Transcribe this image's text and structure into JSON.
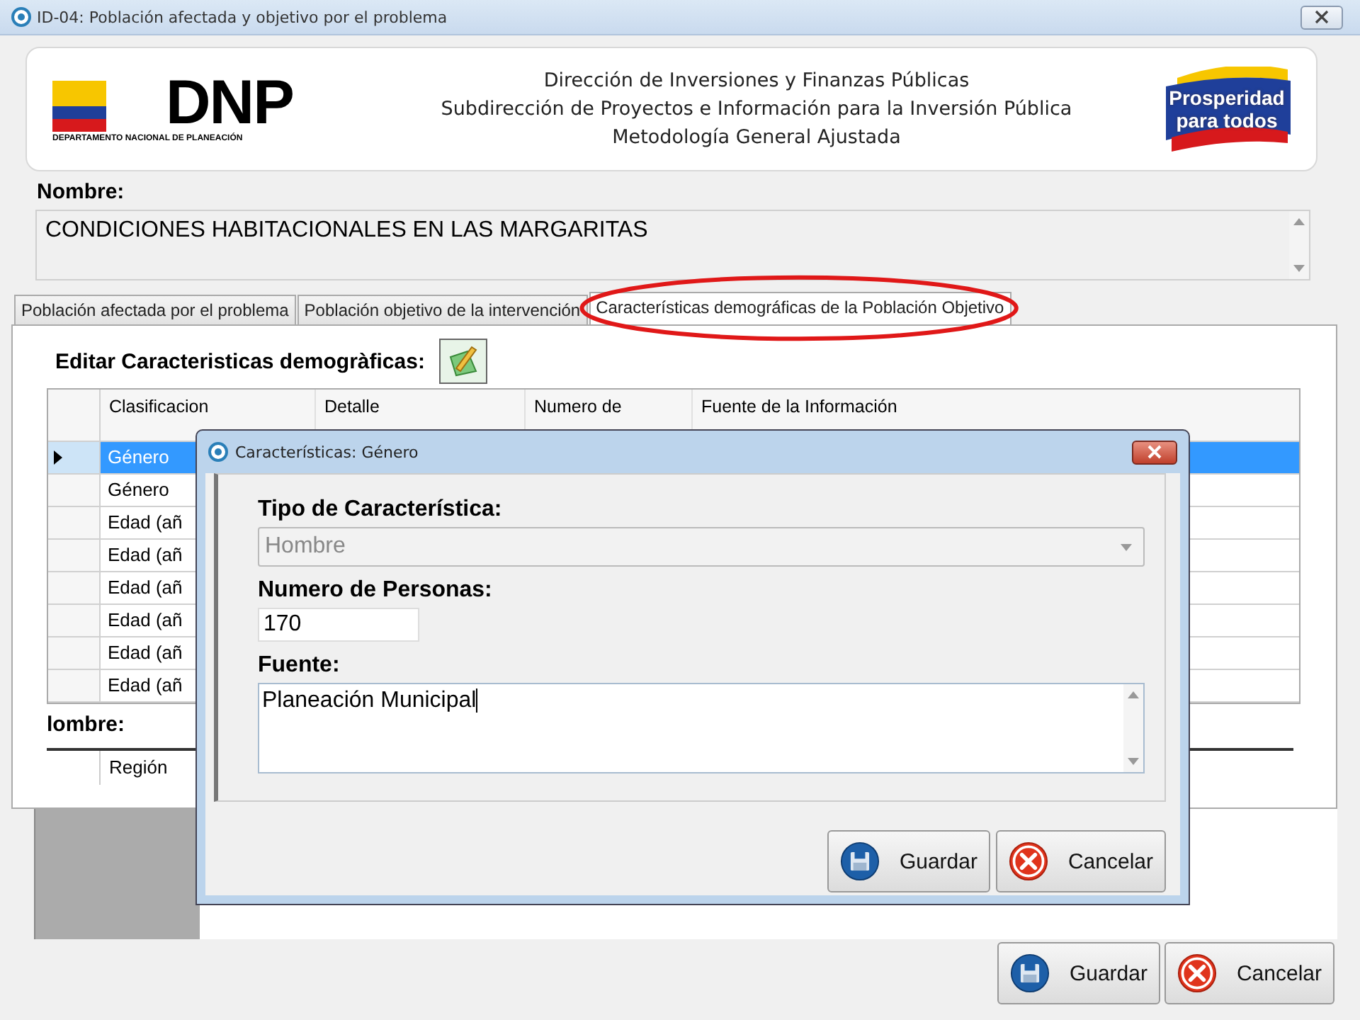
{
  "window": {
    "title": "ID-04: Población afectada y objetivo por el problema"
  },
  "header": {
    "logo_left": {
      "mark": "DNP",
      "caption": "DEPARTAMENTO NACIONAL DE PLANEACIÓN"
    },
    "lines": [
      "Dirección de Inversiones y Finanzas Públicas",
      "Subdirección de Proyectos e Información para la Inversión Pública",
      "Metodología General Ajustada"
    ],
    "logo_right": {
      "line_1": "Prosperidad",
      "line_2": "para todos"
    }
  },
  "nombre": {
    "label": "Nombre:",
    "value": "CONDICIONES HABITACIONALES EN LAS MARGARITAS"
  },
  "tabs": [
    {
      "label": "Población afectada por el problema",
      "selected": false
    },
    {
      "label": "Población objetivo de la intervención",
      "selected": false
    },
    {
      "label": "Características demográficas de la Población Objetivo",
      "selected": true
    }
  ],
  "annotation": {
    "kind": "ellipse"
  },
  "editor": {
    "label": "Editar Caracteristicas demogràficas:"
  },
  "grid": {
    "columns": [
      "Clasificacion",
      "Detalle",
      "Numero de",
      "Fuente de la Información"
    ],
    "rows": [
      {
        "clasificacion": "Género",
        "selected": true
      },
      {
        "clasificacion": "Género",
        "selected": false
      },
      {
        "clasificacion": "Edad (añ",
        "selected": false
      },
      {
        "clasificacion": "Edad (añ",
        "selected": false
      },
      {
        "clasificacion": "Edad (añ",
        "selected": false
      },
      {
        "clasificacion": "Edad (añ",
        "selected": false
      },
      {
        "clasificacion": "Edad (añ",
        "selected": false
      },
      {
        "clasificacion": "Edad (añ",
        "selected": false
      }
    ]
  },
  "lower": {
    "label": "lombre:",
    "columns": [
      "Región"
    ]
  },
  "dialog": {
    "title": "Características: Género",
    "fields": [
      {
        "kind": "combo",
        "label": "Tipo de Característica:",
        "value": "Hombre",
        "disabled": true
      },
      {
        "kind": "text",
        "label": "Numero de Personas:",
        "value": "170"
      },
      {
        "kind": "textarea",
        "label": "Fuente:",
        "value": "Planeación Municipal"
      }
    ],
    "buttons": [
      {
        "kind": "save",
        "label": "Guardar"
      },
      {
        "kind": "cancel",
        "label": "Cancelar"
      }
    ]
  },
  "buttons": [
    {
      "kind": "save",
      "label": "Guardar"
    },
    {
      "kind": "cancel",
      "label": "Cancelar"
    }
  ]
}
